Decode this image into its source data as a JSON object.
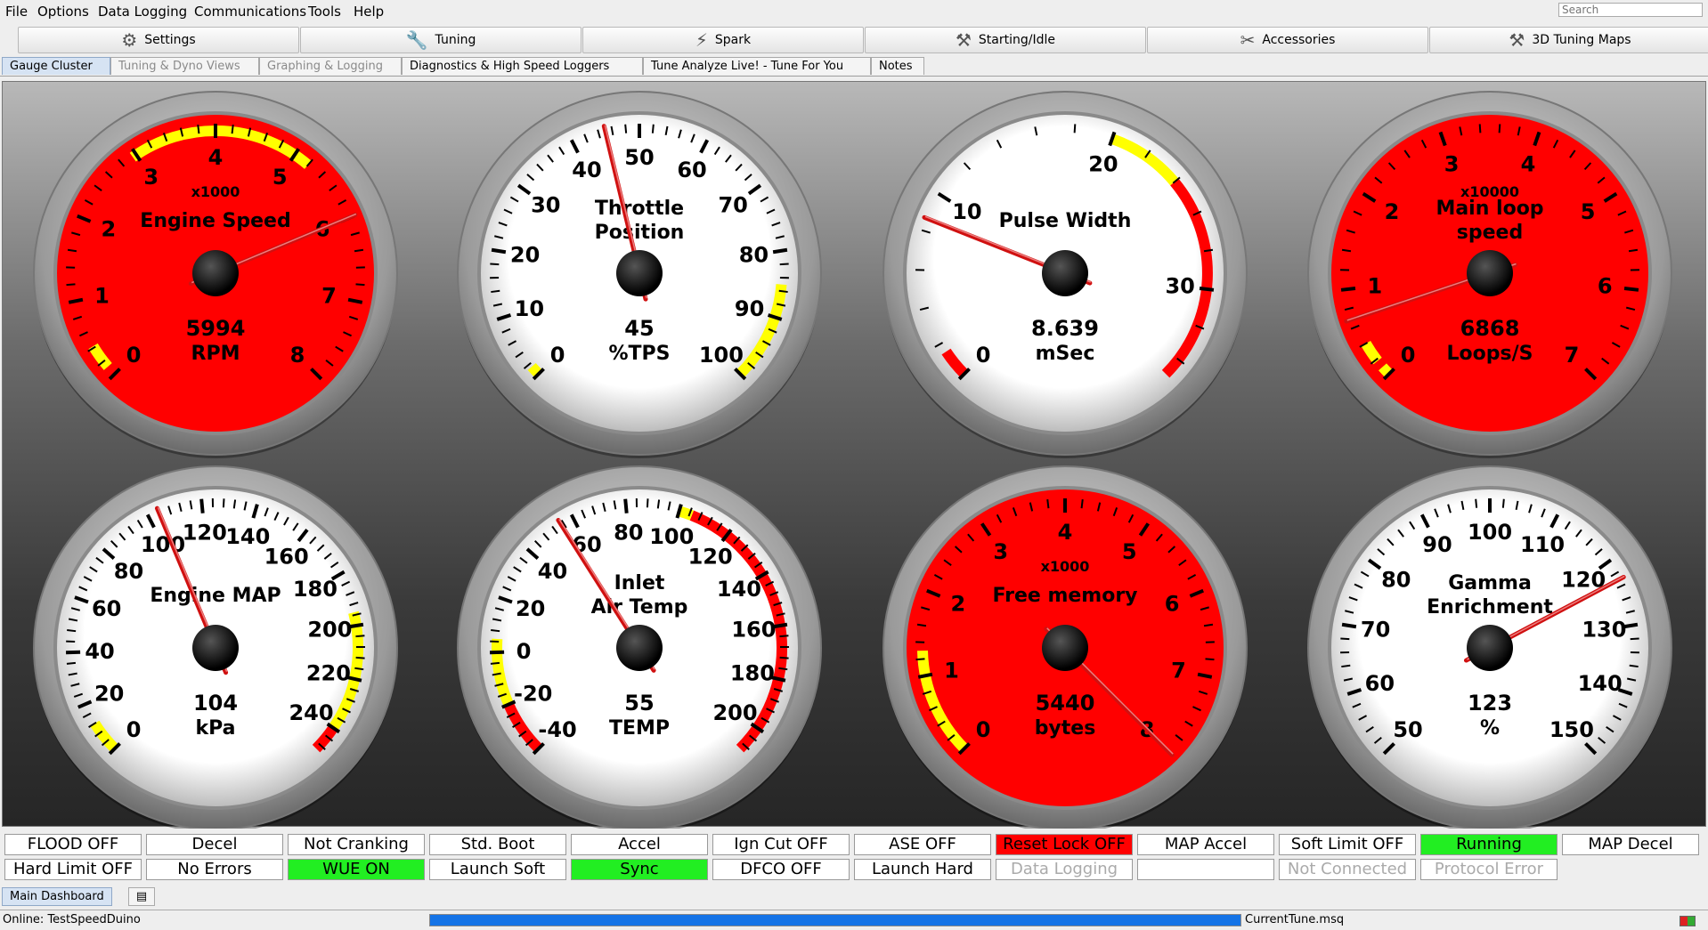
{
  "menu": {
    "items": [
      "File",
      "Options",
      "Data Logging",
      "Communications",
      "Tools",
      "Help"
    ],
    "search_placeholder": "Search"
  },
  "toolbar": {
    "buttons": [
      {
        "label": "Settings",
        "icon": "gear-icon"
      },
      {
        "label": "Tuning",
        "icon": "wrench-icon"
      },
      {
        "label": "Spark",
        "icon": "spark-plug-icon"
      },
      {
        "label": "Starting/Idle",
        "icon": "starter-icon"
      },
      {
        "label": "Accessories",
        "icon": "tools-icon"
      },
      {
        "label": "3D Tuning Maps",
        "icon": "hammer-icon"
      }
    ]
  },
  "tabs": [
    {
      "label": "Gauge Cluster",
      "state": "active"
    },
    {
      "label": "Tuning & Dyno Views",
      "state": "disabled"
    },
    {
      "label": "Graphing & Logging",
      "state": "disabled"
    },
    {
      "label": "Diagnostics & High Speed Loggers",
      "state": "normal"
    },
    {
      "label": "Tune Analyze Live! - Tune For You",
      "state": "normal"
    },
    {
      "label": "Notes",
      "state": "normal"
    }
  ],
  "gauges": [
    {
      "title": [
        "Engine Speed"
      ],
      "multiplier": "x1000",
      "value": "5994",
      "units": "RPM",
      "face": "red",
      "min": 0,
      "max": 8,
      "labels": [
        "0",
        "1",
        "2",
        "3",
        "4",
        "5",
        "6",
        "7",
        "8"
      ],
      "needle": 5.994,
      "bands": [
        {
          "from": 0.12,
          "to": 0.42,
          "color": "yellow"
        },
        {
          "from": 2.95,
          "to": 5.2,
          "color": "yellow"
        }
      ]
    },
    {
      "title": [
        "Throttle",
        "Position"
      ],
      "multiplier": "",
      "value": "45",
      "units": "%TPS",
      "face": "white",
      "min": 0,
      "max": 100,
      "labels": [
        "0",
        "10",
        "20",
        "30",
        "40",
        "50",
        "60",
        "70",
        "80",
        "90",
        "100"
      ],
      "needle": 45,
      "bands": [
        {
          "from": 0,
          "to": 1.5,
          "color": "yellow"
        },
        {
          "from": 85,
          "to": 100,
          "color": "yellow"
        }
      ]
    },
    {
      "title": [
        "Pulse Width"
      ],
      "multiplier": "",
      "value": "8.639",
      "units": "mSec",
      "face": "white",
      "min": 0,
      "max": 35,
      "labels": [
        "0",
        "10",
        "20",
        "30"
      ],
      "label_values": [
        0,
        10,
        20,
        30
      ],
      "needle": 8.639,
      "bands": [
        {
          "from": 0,
          "to": 1.5,
          "color": "red"
        },
        {
          "from": 20,
          "to": 24,
          "color": "yellow"
        },
        {
          "from": 24,
          "to": 35,
          "color": "red"
        }
      ]
    },
    {
      "title": [
        "Main loop",
        "speed"
      ],
      "multiplier": "x10000",
      "value": "6868",
      "units": "Loops/S",
      "face": "red",
      "min": 0,
      "max": 7,
      "labels": [
        "0",
        "1",
        "2",
        "3",
        "4",
        "5",
        "6",
        "7"
      ],
      "needle": 0.6868,
      "bands": [
        {
          "from": 0.0,
          "to": 0.1,
          "color": "yellow"
        },
        {
          "from": 0.18,
          "to": 0.4,
          "color": "yellow"
        }
      ]
    },
    {
      "title": [
        "Engine MAP"
      ],
      "multiplier": "",
      "value": "104",
      "units": "kPa",
      "face": "white",
      "min": 0,
      "max": 250,
      "labels": [
        "0",
        "20",
        "40",
        "60",
        "80",
        "100",
        "120",
        "140",
        "160",
        "180",
        "200",
        "220",
        "240"
      ],
      "label_step": 20,
      "needle": 104,
      "bands": [
        {
          "from": 0,
          "to": 12,
          "color": "yellow"
        },
        {
          "from": 195,
          "to": 240,
          "color": "yellow"
        },
        {
          "from": 240,
          "to": 250,
          "color": "red"
        }
      ]
    },
    {
      "title": [
        "Inlet",
        "Air Temp"
      ],
      "multiplier": "",
      "value": "55",
      "units": "TEMP",
      "face": "white",
      "min": -40,
      "max": 210,
      "labels": [
        "-40",
        "-20",
        "0",
        "20",
        "40",
        "60",
        "80",
        "100",
        "120",
        "140",
        "160",
        "180",
        "200"
      ],
      "label_step": 20,
      "needle": 55,
      "bands": [
        {
          "from": -40,
          "to": -20,
          "color": "red"
        },
        {
          "from": -20,
          "to": 5,
          "color": "yellow"
        },
        {
          "from": 100,
          "to": 105,
          "color": "yellow"
        },
        {
          "from": 105,
          "to": 210,
          "color": "red"
        }
      ]
    },
    {
      "title": [
        "Free memory"
      ],
      "multiplier": "x1000",
      "value": "5440",
      "units": "bytes",
      "face": "red",
      "min": 0,
      "max": 8,
      "labels": [
        "0",
        "1",
        "2",
        "3",
        "4",
        "5",
        "6",
        "7",
        "8"
      ],
      "needle": 8.0,
      "bands": [
        {
          "from": 0,
          "to": 1.3,
          "color": "yellow"
        }
      ]
    },
    {
      "title": [
        "Gamma",
        "Enrichment"
      ],
      "multiplier": "",
      "value": "123",
      "units": "%",
      "face": "white",
      "min": 50,
      "max": 150,
      "labels": [
        "50",
        "60",
        "70",
        "80",
        "90",
        "100",
        "110",
        "120",
        "130",
        "140",
        "150"
      ],
      "needle": 123,
      "bands": []
    }
  ],
  "indicators": [
    [
      {
        "label": "FLOOD OFF",
        "style": "white"
      },
      {
        "label": "Decel",
        "style": "white"
      },
      {
        "label": "Not Cranking",
        "style": "white"
      },
      {
        "label": "Std. Boot",
        "style": "white"
      },
      {
        "label": "Accel",
        "style": "white"
      },
      {
        "label": "Ign Cut OFF",
        "style": "white"
      },
      {
        "label": "ASE OFF",
        "style": "white"
      },
      {
        "label": "Reset Lock OFF",
        "style": "red"
      },
      {
        "label": "MAP Accel",
        "style": "white"
      },
      {
        "label": "Soft Limit OFF",
        "style": "white"
      },
      {
        "label": "Running",
        "style": "green"
      },
      {
        "label": "MAP Decel",
        "style": "white"
      }
    ],
    [
      {
        "label": "Hard Limit OFF",
        "style": "white"
      },
      {
        "label": "No Errors",
        "style": "white"
      },
      {
        "label": "WUE ON",
        "style": "green"
      },
      {
        "label": "Launch Soft",
        "style": "white"
      },
      {
        "label": "Sync",
        "style": "green"
      },
      {
        "label": "DFCO OFF",
        "style": "white"
      },
      {
        "label": "Launch Hard",
        "style": "white"
      },
      {
        "label": "Data Logging",
        "style": "disabled"
      },
      {
        "label": "",
        "style": "white"
      },
      {
        "label": "Not Connected",
        "style": "disabled"
      },
      {
        "label": "Protocol Error",
        "style": "disabled"
      }
    ]
  ],
  "bottom_tabs": {
    "main": "Main Dashboard"
  },
  "status": {
    "text": "Online: TestSpeedDuino",
    "progress": 1.0,
    "tune_file": "CurrentTune.msq"
  }
}
